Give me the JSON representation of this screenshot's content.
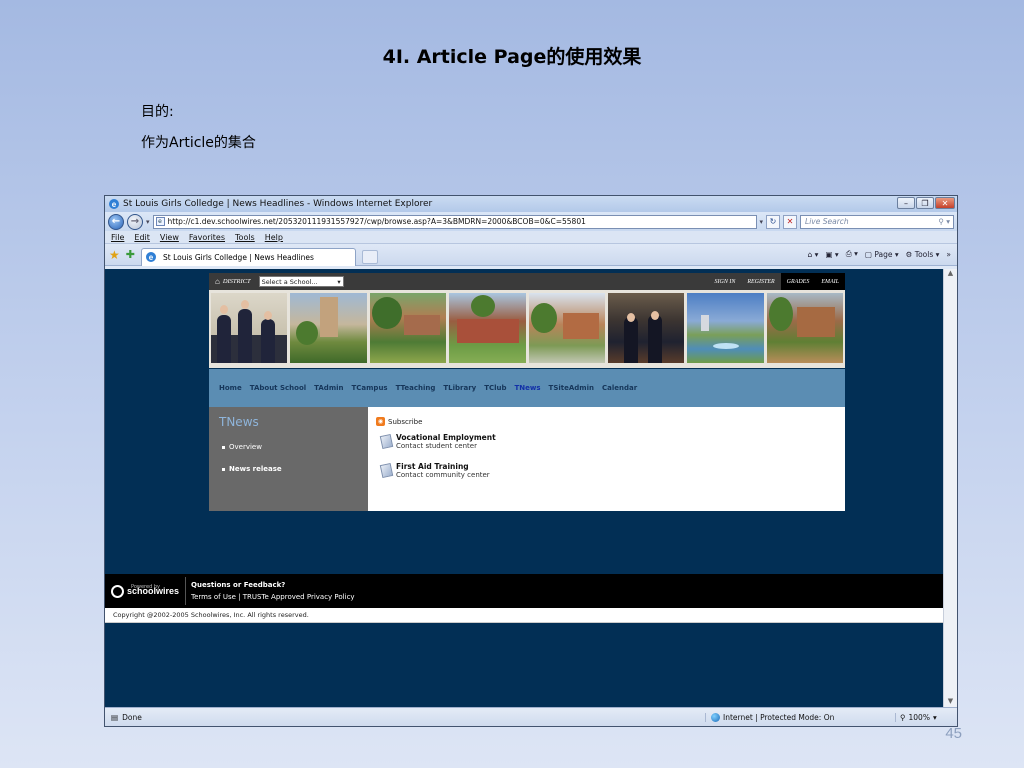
{
  "slide": {
    "title": "4I. Article Page的使用效果",
    "purpose_label": "目的:",
    "purpose_text": "作为Article的集合",
    "page_number": "45"
  },
  "browser": {
    "window_title": "St Louis Girls Colledge | News Headlines - Windows Internet Explorer",
    "url": "http://c1.dev.schoolwires.net/205320111931557927/cwp/browse.asp?A=3&BMDRN=2000&BCOB=0&C=55801",
    "search_placeholder": "Live Search",
    "menu": [
      "File",
      "Edit",
      "View",
      "Favorites",
      "Tools",
      "Help"
    ],
    "tab_label": "St Louis Girls Colledge | News Headlines",
    "cmd_page": "Page",
    "cmd_tools": "Tools",
    "status_done": "Done",
    "status_zone": "Internet | Protected Mode: On",
    "status_zoom": "100%"
  },
  "site": {
    "district_label": "DISTRICT",
    "school_select": "Select a School...",
    "sign_in": "SIGN IN",
    "register": "REGISTER",
    "grades": "GRADES",
    "email": "EMAIL",
    "nav": [
      "Home",
      "TAbout School",
      "TAdmin",
      "TCampus",
      "TTeaching",
      "TLibrary",
      "TClub",
      "TNews",
      "TSiteAdmin",
      "Calendar"
    ],
    "active_nav": "TNews",
    "sidebar_title": "TNews",
    "sidebar_items": [
      "Overview",
      "News release"
    ],
    "subscribe": "Subscribe",
    "articles": [
      {
        "title": "Vocational Employment",
        "subtitle": "Contact student center"
      },
      {
        "title": "First Aid Training",
        "subtitle": "Contact community center"
      }
    ],
    "powered_by": "Powered by",
    "logo_text": "schoolwires",
    "feedback_title": "Questions or Feedback?",
    "feedback_links": "Terms of Use | TRUSTe Approved Privacy Policy",
    "copyright": "Copyright @2002-2005 Schoolwires, Inc. All rights reserved."
  },
  "colors": {
    "page_bg": "#022f55",
    "nav_bar": "#5b8db3",
    "sidebar": "#696969"
  }
}
